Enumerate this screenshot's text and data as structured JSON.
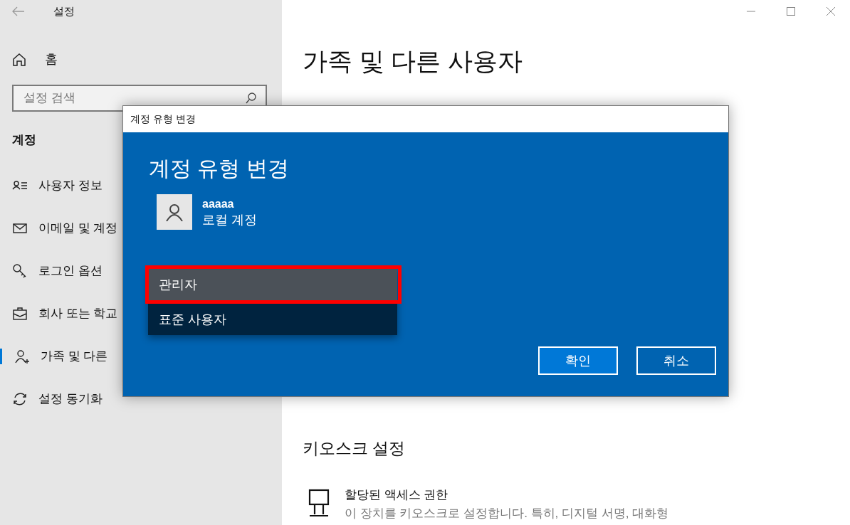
{
  "window": {
    "title": "설정"
  },
  "sidebar": {
    "home": "홈",
    "search": {
      "placeholder": "설정 검색"
    },
    "section": "계정",
    "items": [
      {
        "kind": "user-info",
        "label": "사용자 정보",
        "selected": false
      },
      {
        "kind": "mail",
        "label": "이메일 및 계정",
        "selected": false
      },
      {
        "kind": "key",
        "label": "로그인 옵션",
        "selected": false
      },
      {
        "kind": "briefcase",
        "label": "회사 또는 학교",
        "selected": false
      },
      {
        "kind": "family",
        "label": "가족 및 다른",
        "selected": true
      },
      {
        "kind": "sync",
        "label": "설정 동기화",
        "selected": false
      }
    ]
  },
  "main": {
    "title": "가족 및 다른 사용자",
    "kiosk": {
      "heading": "키오스크 설정",
      "item_title": "할당된 액세스 권한",
      "item_description": "이 장치를 키오스크로 설정합니다. 특히, 디지털 서명, 대화형"
    }
  },
  "dialog": {
    "title": "계정 유형 변경",
    "heading": "계정 유형 변경",
    "account": {
      "name": "aaaaa",
      "type": "로컬 계정"
    },
    "options": [
      {
        "label": "관리자",
        "selected": true
      },
      {
        "label": "표준 사용자",
        "selected": false
      }
    ],
    "buttons": [
      {
        "kind": "primary",
        "label": "확인"
      },
      {
        "kind": "secondary",
        "label": "취소"
      }
    ]
  }
}
